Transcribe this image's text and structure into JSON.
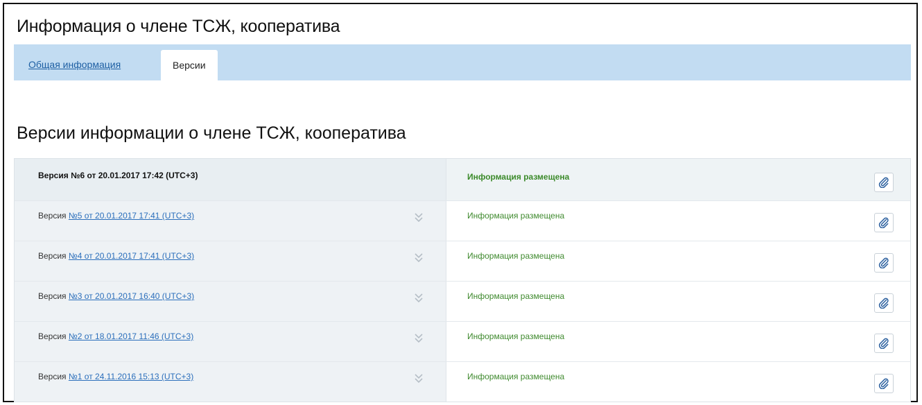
{
  "header": {
    "title": "Информация о члене ТСЖ, кооператива"
  },
  "tabs": [
    {
      "label": "Общая информация",
      "active": false
    },
    {
      "label": "Версии",
      "active": true
    }
  ],
  "section": {
    "title": "Версии информации о члене ТСЖ, кооператива"
  },
  "versions": [
    {
      "prefix": "Версия",
      "link": "№6 от 20.01.2017 17:42 (UTC+3)",
      "status": "Информация размещена",
      "current": true
    },
    {
      "prefix": "Версия",
      "link": "№5 от 20.01.2017 17:41 (UTC+3)",
      "status": "Информация размещена",
      "current": false
    },
    {
      "prefix": "Версия",
      "link": "№4 от 20.01.2017 17:41 (UTC+3)",
      "status": "Информация размещена",
      "current": false
    },
    {
      "prefix": "Версия",
      "link": "№3 от 20.01.2017 16:40 (UTC+3)",
      "status": "Информация размещена",
      "current": false
    },
    {
      "prefix": "Версия",
      "link": "№2 от 18.01.2017 11:46 (UTC+3)",
      "status": "Информация размещена",
      "current": false
    },
    {
      "prefix": "Версия",
      "link": "№1 от 24.11.2016 15:13 (UTC+3)",
      "status": "Информация размещена",
      "current": false
    }
  ],
  "icons": {
    "attach": "paperclip-icon",
    "expand": "chevron-double-down-icon"
  },
  "colors": {
    "tab_bar": "#c2dcf2",
    "link": "#2a6ebb",
    "status": "#3f8a2e"
  }
}
